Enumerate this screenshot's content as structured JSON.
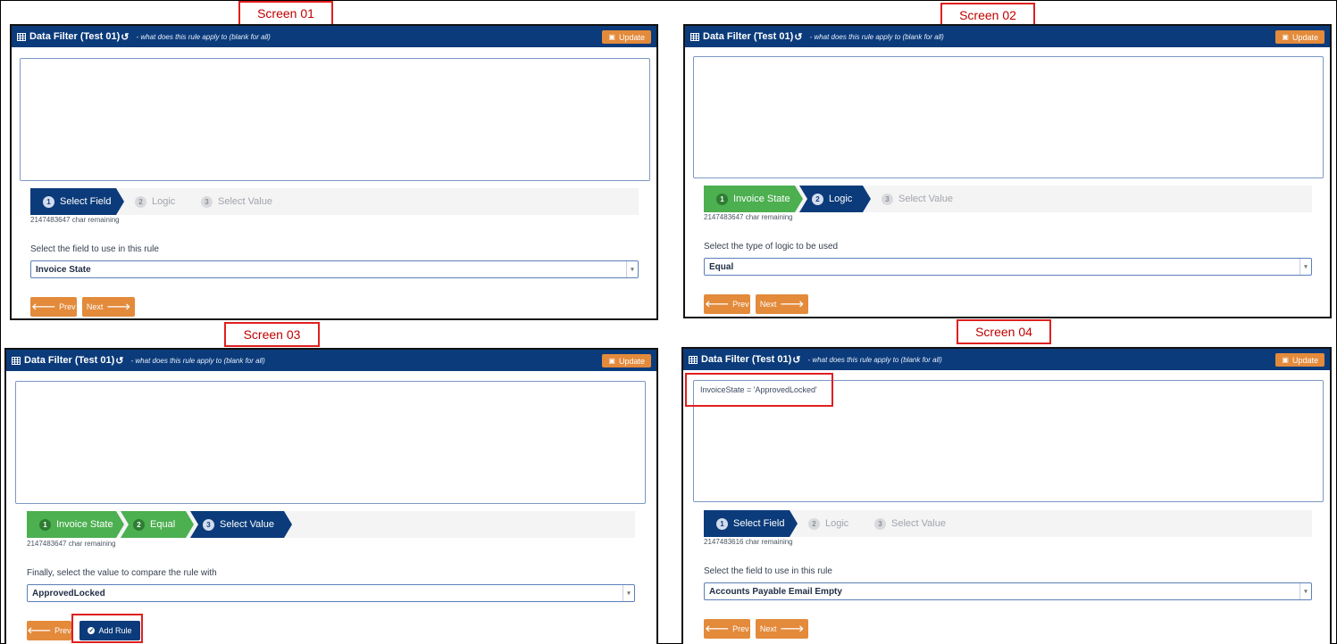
{
  "screens": [
    {
      "label": "Screen 01",
      "panel_title": "Data Filter (Test 01)",
      "hint": "- what does this rule apply to (blank for all)",
      "update_label": "Update",
      "rule_text": "",
      "steps": [
        {
          "num": "1",
          "label": "Select Field",
          "state": "active"
        },
        {
          "num": "2",
          "label": "Logic",
          "state": "todo"
        },
        {
          "num": "3",
          "label": "Select Value",
          "state": "todo"
        }
      ],
      "chars_remaining": "2147483647 char remaining",
      "prompt": "Select the field to use in this rule",
      "selected_value": "Invoice State",
      "prev_label": "Prev",
      "next_label": "Next"
    },
    {
      "label": "Screen 02",
      "panel_title": "Data Filter (Test 01)",
      "hint": "- what does this rule apply to (blank for all)",
      "update_label": "Update",
      "rule_text": "",
      "steps": [
        {
          "num": "1",
          "label": "Invoice State",
          "state": "done"
        },
        {
          "num": "2",
          "label": "Logic",
          "state": "active"
        },
        {
          "num": "3",
          "label": "Select Value",
          "state": "todo"
        }
      ],
      "chars_remaining": "2147483647 char remaining",
      "prompt": "Select the type of logic to be used",
      "selected_value": "Equal",
      "prev_label": "Prev",
      "next_label": "Next"
    },
    {
      "label": "Screen 03",
      "panel_title": "Data Filter (Test 01)",
      "hint": "- what does this rule apply to (blank for all)",
      "update_label": "Update",
      "rule_text": "",
      "steps": [
        {
          "num": "1",
          "label": "Invoice State",
          "state": "done"
        },
        {
          "num": "2",
          "label": "Equal",
          "state": "done"
        },
        {
          "num": "3",
          "label": "Select Value",
          "state": "active"
        }
      ],
      "chars_remaining": "2147483647 char remaining",
      "prompt": "Finally, select the value to compare the rule with",
      "selected_value": "ApprovedLocked",
      "prev_label": "Prev",
      "add_rule_label": "Add Rule"
    },
    {
      "label": "Screen 04",
      "panel_title": "Data Filter (Test 01)",
      "hint": "- what does this rule apply to (blank for all)",
      "update_label": "Update",
      "rule_text": "InvoiceState = 'ApprovedLocked'",
      "steps": [
        {
          "num": "1",
          "label": "Select Field",
          "state": "active"
        },
        {
          "num": "2",
          "label": "Logic",
          "state": "todo"
        },
        {
          "num": "3",
          "label": "Select Value",
          "state": "todo"
        }
      ],
      "chars_remaining": "2147483616 char remaining",
      "prompt": "Select the field to use in this rule",
      "selected_value": "Accounts Payable Email Empty",
      "prev_label": "Prev",
      "next_label": "Next"
    }
  ],
  "colors": {
    "header": "#0b3b7a",
    "orange": "#e38a3b",
    "green": "#4caf50",
    "highlight": "#e01f1f"
  },
  "icons": [
    "table-icon",
    "history-icon",
    "save-icon",
    "arrow-left-icon",
    "arrow-right-icon",
    "check-circle-icon",
    "dropdown-caret-icon"
  ]
}
